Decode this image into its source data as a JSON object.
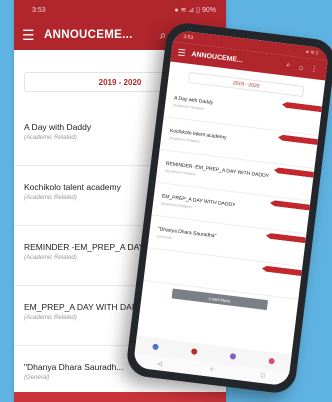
{
  "colors": {
    "accent": "#b0262c",
    "background": "#5fb3e2"
  },
  "back_screen": {
    "status_time": "3:53",
    "status_icons": "● ≋ ⊿ ▯ 90%",
    "title": "ANNOUCEME...",
    "icons": {
      "menu": "menu-icon",
      "search": "search-icon",
      "home": "home-icon",
      "more": "more-vert-icon"
    },
    "year": "2019 - 2020",
    "items": [
      {
        "title": "A Day with Daddy",
        "subtitle": "(Academic Related)"
      },
      {
        "title": "Kochikolo talent academy",
        "subtitle": "(Academic Related)"
      },
      {
        "title": "REMINDER -EM_PREP_A DAY W...",
        "subtitle": "(Academic Related)"
      },
      {
        "title": "EM_PREP_A DAY WITH DAD...",
        "subtitle": "(Academic Related)"
      },
      {
        "title": "\"Dhanya Dhara Sauradh...",
        "subtitle": "(General)"
      }
    ]
  },
  "phone": {
    "status_time": "3:53",
    "status_icons": "● ≋ ▯",
    "title": "ANNOUCEME...",
    "year": "2019 - 2020",
    "items": [
      {
        "title": "A Day with Daddy",
        "subtitle": "(Academic Related)"
      },
      {
        "title": "Kochikolo talent academy",
        "subtitle": "(Academic Related)"
      },
      {
        "title": "REMINDER -EM_PREP_A DAY WITH DADDY",
        "subtitle": "(Academic Related)"
      },
      {
        "title": "EM_PREP_A DAY WITH DADDY",
        "subtitle": "(Academic Related)"
      },
      {
        "title": "\"Dhanya Dhara Sauradha\"",
        "subtitle": "(General)"
      },
      {
        "title": "",
        "subtitle": ""
      }
    ],
    "load_more": "Load More",
    "sys_nav": {
      "back": "◁",
      "home": "○",
      "recent": "□"
    }
  }
}
